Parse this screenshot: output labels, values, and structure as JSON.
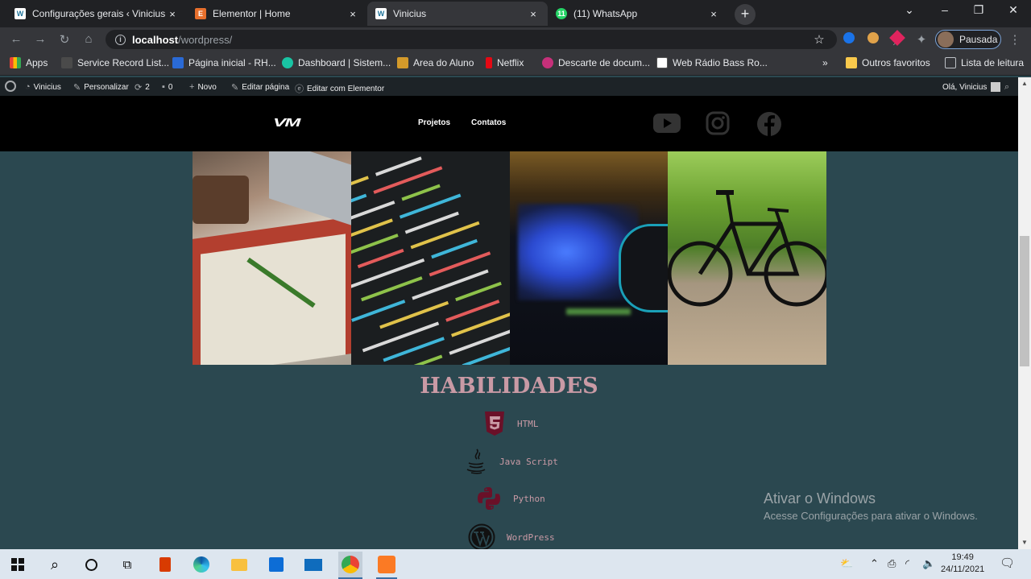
{
  "browser": {
    "tabs": [
      {
        "title": "Configurações gerais ‹ Vinicius —",
        "active": false,
        "icon": "wordpress-icon"
      },
      {
        "title": "Elementor | Home",
        "active": false,
        "icon": "elementor-icon"
      },
      {
        "title": "Vinicius",
        "active": true,
        "icon": "wordpress-icon"
      },
      {
        "title": "(11) WhatsApp",
        "active": false,
        "icon": "whatsapp-icon",
        "badge": "11"
      }
    ],
    "close_glyph": "×",
    "new_tab_glyph": "+",
    "url_host": "localhost",
    "url_path": "/wordpress/",
    "profile_label": "Pausada",
    "bookmarks": [
      "Apps",
      "Service Record List...",
      "Página inicial - RH...",
      "Dashboard | Sistem...",
      "Area do Aluno",
      "Netflix",
      "Descarte de docum...",
      "Web Rádio Bass Ro..."
    ],
    "bookmark_overflow": "»",
    "other_bookmarks": "Outros favoritos",
    "reading_list": "Lista de leitura"
  },
  "wp_admin_bar": {
    "site_name": "Vinicius",
    "customize": "Personalizar",
    "updates_count": "2",
    "comments_count": "0",
    "new_label": "Novo",
    "edit_page": "Editar página",
    "edit_elementor": "Editar com Elementor",
    "greeting": "Olá, Vinicius"
  },
  "site": {
    "logo": "VM",
    "nav": [
      "Projetos",
      "Contatos"
    ],
    "social_icons": [
      "youtube-icon",
      "instagram-icon",
      "facebook-icon"
    ],
    "gallery": [
      "notebook-desk-image",
      "code-screen-image",
      "gaming-headset-image",
      "bicycle-image"
    ],
    "skills_title": "HABILIDADES",
    "skills": [
      {
        "label": "HTML",
        "icon": "html5-icon"
      },
      {
        "label": "Java Script",
        "icon": "java-icon"
      },
      {
        "label": "Python",
        "icon": "python-icon"
      },
      {
        "label": "WordPress",
        "icon": "wordpress-icon"
      }
    ],
    "colors": {
      "background": "#2b4850",
      "accent": "#c99aa5",
      "header": "#000000"
    }
  },
  "watermark": {
    "line1": "Ativar o Windows",
    "line2": "Acesse Configurações para ativar o Windows."
  },
  "taskbar": {
    "time": "19:49",
    "date": "24/11/2021"
  }
}
